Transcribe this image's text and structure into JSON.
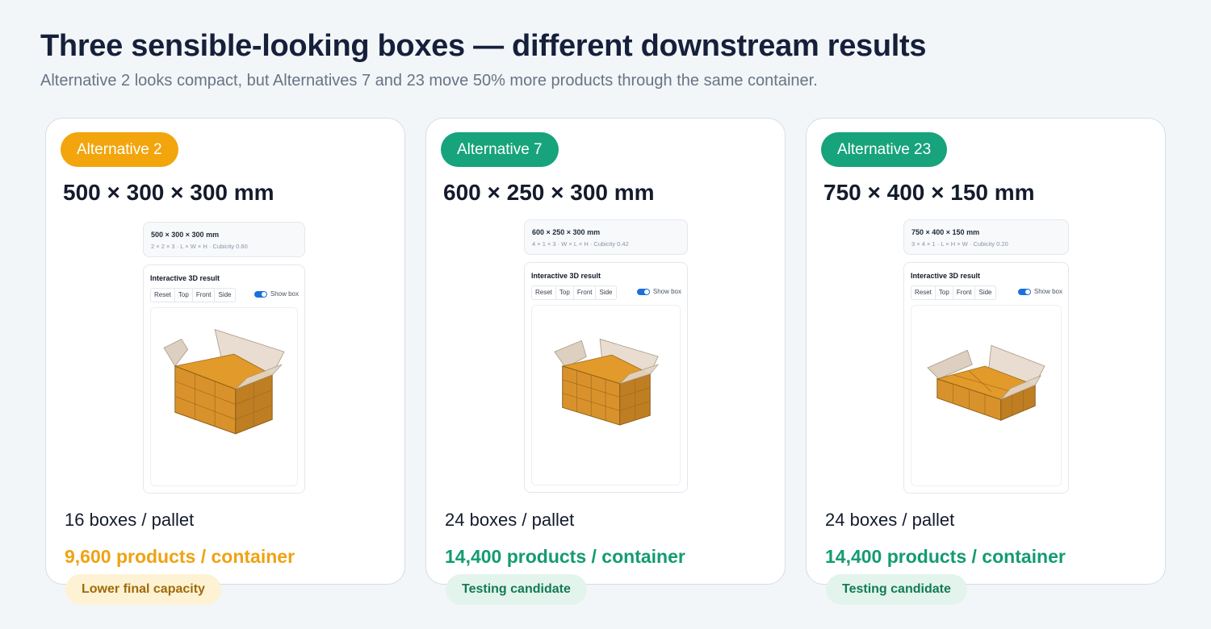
{
  "header": {
    "title": "Three sensible-looking boxes — different downstream results",
    "subtitle": "Alternative 2 looks compact, but Alternatives 7 and 23 move 50% more products through the same container."
  },
  "colors": {
    "orange": "#f2a50c",
    "green": "#17a37b",
    "orange_text": "#eea312",
    "green_text": "#139b72",
    "orange_tag_bg": "#fdf2d3",
    "orange_tag_text": "#a06a0a",
    "green_tag_bg": "#e3f4ec",
    "green_tag_text": "#127a57"
  },
  "cards": [
    {
      "badge": "Alternative 2",
      "dimensions": "500 × 300 × 300 mm",
      "mini_title": "500 × 300 × 300 mm",
      "mini_caption": "2 × 2 × 3 · L × W × H · Cubicity 0.60",
      "result_title": "Interactive 3D result",
      "controls": [
        "Reset",
        "Top",
        "Front",
        "Side"
      ],
      "toggle_label": "Show box",
      "toggle_on": true,
      "per_pallet": "16 boxes / pallet",
      "per_container": "9,600 products / container",
      "tag": "Lower final capacity"
    },
    {
      "badge": "Alternative 7",
      "dimensions": "600 × 250 × 300 mm",
      "mini_title": "600 × 250 × 300 mm",
      "mini_caption": "4 × 1 × 3 · W × L × H · Cubicity 0.42",
      "result_title": "Interactive 3D result",
      "controls": [
        "Reset",
        "Top",
        "Front",
        "Side"
      ],
      "toggle_label": "Show box",
      "toggle_on": true,
      "per_pallet": "24 boxes / pallet",
      "per_container": "14,400 products / container",
      "tag": "Testing candidate"
    },
    {
      "badge": "Alternative 23",
      "dimensions": "750 × 400 × 150 mm",
      "mini_title": "750 × 400 × 150 mm",
      "mini_caption": "3 × 4 × 1 · L × H × W · Cubicity 0.20",
      "result_title": "Interactive 3D result",
      "controls": [
        "Reset",
        "Top",
        "Front",
        "Side"
      ],
      "toggle_label": "Show box",
      "toggle_on": true,
      "per_pallet": "24 boxes / pallet",
      "per_container": "14,400 products / container",
      "tag": "Testing candidate"
    }
  ]
}
